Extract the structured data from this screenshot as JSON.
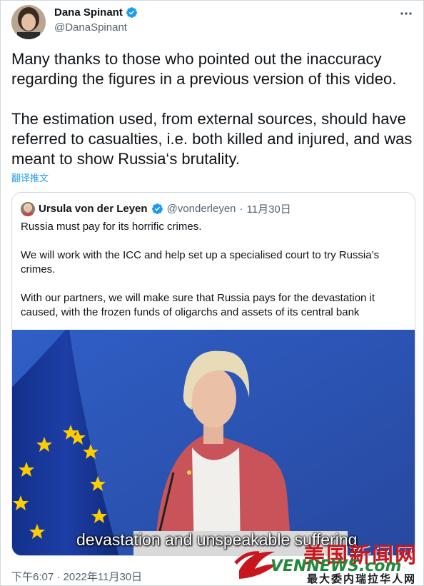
{
  "tweet": {
    "author": {
      "name": "Dana Spinant",
      "handle": "@DanaSpinant",
      "verified_icon": "verified-badge-icon"
    },
    "more_icon": "more-dots-icon",
    "paragraphs": [
      "Many thanks to those who pointed out the inaccuracy regarding the figures in a previous version of this video.",
      "The estimation used, from external sources, should have referred to casualties, i.e. both killed and injured, and was meant to show Russia‘s brutality."
    ],
    "translate_label": "翻译推文",
    "timestamp": "下午6:07 · 2022年11月30日"
  },
  "quote": {
    "author": {
      "name": "Ursula von der Leyen",
      "handle": "@vonderleyen",
      "separator": "·",
      "date": "11月30日"
    },
    "paragraphs": [
      "Russia must pay for its horrific crimes.",
      "We will work with the ICC and help set up a specialised court to try Russia’s crimes.",
      "With our partners, we will make sure that Russia pays for the devastation it caused, with the frozen funds of oligarchs and assets of its central bank"
    ],
    "video_caption": "devastation and unspeakable suffering"
  },
  "watermark": {
    "title": "美国新闻网",
    "url": "VENNEWS.com",
    "slogan": "最大委内瑞拉华人网"
  },
  "colors": {
    "link": "#1d9bf0",
    "secondary_text": "#536471",
    "verified": "#1d9bf0",
    "eu_blue": "#2a52b6",
    "eu_star": "#ffcc00"
  }
}
